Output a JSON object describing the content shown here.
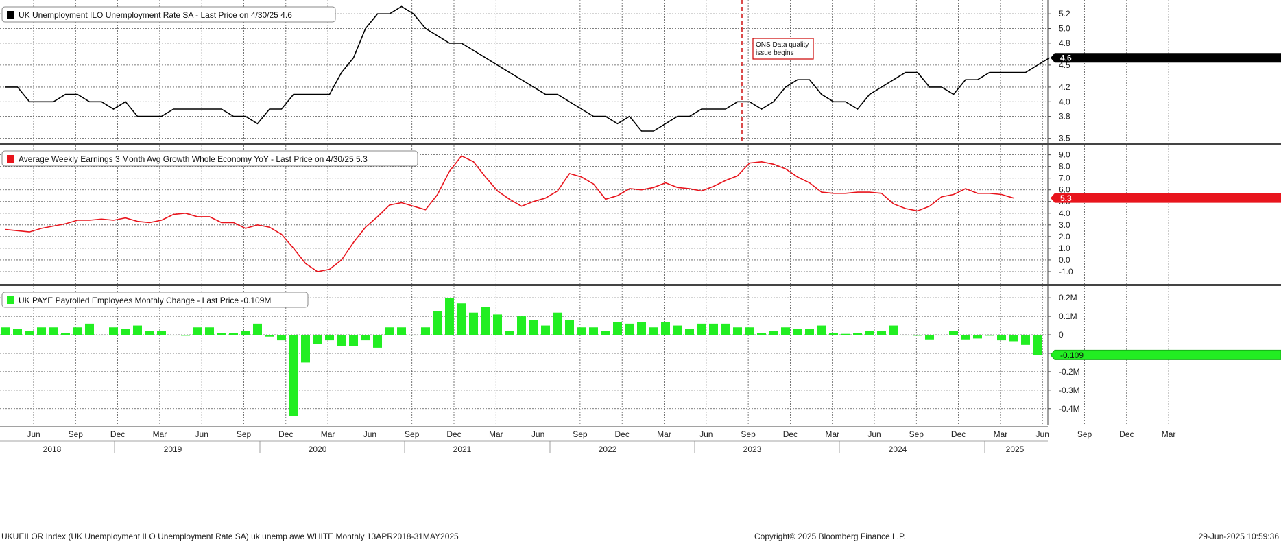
{
  "colors": {
    "unemp": "#000000",
    "awe": "#e8141c",
    "paye": "#22ee22",
    "paye_border": "#16b016",
    "grid": "#555555",
    "annotation": "#cc0000"
  },
  "x_axis": {
    "months": [
      "Jun",
      "Sep",
      "Dec",
      "Mar",
      "Jun",
      "Sep",
      "Dec",
      "Mar",
      "Jun",
      "Sep",
      "Dec",
      "Mar",
      "Jun",
      "Sep",
      "Dec",
      "Mar",
      "Jun",
      "Sep",
      "Dec",
      "Mar",
      "Jun",
      "Sep",
      "Dec",
      "Mar",
      "Jun",
      "Sep",
      "Dec",
      "Mar"
    ],
    "years": [
      "2018",
      "2019",
      "2020",
      "2021",
      "2022",
      "2023",
      "2024",
      "2025"
    ]
  },
  "footer": {
    "left": "UKUEILOR Index (UK Unemployment ILO Unemployment Rate SA) uk unemp awe WHITE  Monthly 13APR2018-31MAY2025",
    "center": "Copyright© 2025 Bloomberg Finance L.P.",
    "right": "29-Jun-2025 10:59:36"
  },
  "chart_data": [
    {
      "type": "line",
      "title": "UK Unemployment ILO Unemployment Rate SA - Last Price on 4/30/25 4.6",
      "last_value_label": "4.6",
      "y_ticks": [
        "3.5",
        "3.8",
        "4.0",
        "4.2",
        "4.5",
        "4.8",
        "5.0",
        "5.2"
      ],
      "ylim": [
        3.45,
        5.37
      ],
      "annotation": {
        "lines": [
          "ONS Data quality",
          "issue begins"
        ],
        "x_index": 62
      },
      "series": [
        {
          "values": [
            4.2,
            4.2,
            4.0,
            4.0,
            4.0,
            4.1,
            4.1,
            4.0,
            4.0,
            3.9,
            4.0,
            3.8,
            3.8,
            3.8,
            3.9,
            3.9,
            3.9,
            3.9,
            3.9,
            3.8,
            3.8,
            3.7,
            3.9,
            3.9,
            4.1,
            4.1,
            4.1,
            4.1,
            4.4,
            4.6,
            5.0,
            5.2,
            5.2,
            5.3,
            5.2,
            5.0,
            4.9,
            4.8,
            4.8,
            4.7,
            4.6,
            4.5,
            4.4,
            4.3,
            4.2,
            4.1,
            4.1,
            4.0,
            3.9,
            3.8,
            3.8,
            3.7,
            3.8,
            3.6,
            3.6,
            3.7,
            3.8,
            3.8,
            3.9,
            3.9,
            3.9,
            4.0,
            4.0,
            3.9,
            4.0,
            4.2,
            4.3,
            4.3,
            4.1,
            4.0,
            4.0,
            3.9,
            4.1,
            4.2,
            4.3,
            4.4,
            4.4,
            4.2,
            4.2,
            4.1,
            4.3,
            4.3,
            4.4,
            4.4,
            4.4,
            4.4,
            4.5,
            4.6
          ]
        }
      ]
    },
    {
      "type": "line",
      "title": "Average Weekly Earnings 3 Month Avg Growth Whole Economy YoY - Last Price on 4/30/25 5.3",
      "last_value_label": "5.3",
      "y_ticks": [
        "-1.0",
        "0.0",
        "1.0",
        "2.0",
        "3.0",
        "4.0",
        "5.0",
        "6.0",
        "7.0",
        "8.0",
        "9.0"
      ],
      "ylim": [
        -2.0,
        9.8
      ],
      "series": [
        {
          "values": [
            2.6,
            2.5,
            2.4,
            2.7,
            2.9,
            3.1,
            3.4,
            3.4,
            3.5,
            3.4,
            3.6,
            3.3,
            3.2,
            3.4,
            3.9,
            4.0,
            3.7,
            3.7,
            3.2,
            3.2,
            2.7,
            3.0,
            2.8,
            2.2,
            1.0,
            -0.3,
            -1.0,
            -0.8,
            0.0,
            1.5,
            2.8,
            3.7,
            4.7,
            4.9,
            4.6,
            4.3,
            5.6,
            7.6,
            8.9,
            8.4,
            7.1,
            5.9,
            5.2,
            4.6,
            5.0,
            5.3,
            5.9,
            7.4,
            7.1,
            6.5,
            5.2,
            5.5,
            6.1,
            6.0,
            6.2,
            6.6,
            6.2,
            6.1,
            5.9,
            6.3,
            6.8,
            7.2,
            8.3,
            8.4,
            8.2,
            7.8,
            7.1,
            6.6,
            5.8,
            5.7,
            5.7,
            5.8,
            5.8,
            5.7,
            4.8,
            4.4,
            4.2,
            4.6,
            5.4,
            5.6,
            6.1,
            5.7,
            5.7,
            5.6,
            5.3
          ]
        }
      ]
    },
    {
      "type": "bar",
      "title": "UK PAYE Payrolled Employees Monthly Change - Last Price -0.109M",
      "last_value_label": "-0.109",
      "y_ticks": [
        "-0.4M",
        "-0.3M",
        "-0.2M",
        "-0.1M",
        "0",
        "0.1M",
        "0.2M"
      ],
      "ylim": [
        -0.49,
        0.26
      ],
      "series": [
        {
          "values": [
            0.04,
            0.03,
            0.02,
            0.04,
            0.04,
            0.01,
            0.04,
            0.06,
            0.0,
            0.04,
            0.03,
            0.05,
            0.02,
            0.02,
            0.0,
            -0.005,
            0.04,
            0.04,
            0.01,
            0.01,
            0.02,
            0.06,
            -0.01,
            -0.03,
            -0.44,
            -0.15,
            -0.05,
            -0.03,
            -0.06,
            -0.06,
            -0.03,
            -0.07,
            0.04,
            0.04,
            0.0,
            0.04,
            0.13,
            0.2,
            0.17,
            0.12,
            0.15,
            0.11,
            0.02,
            0.1,
            0.08,
            0.05,
            0.12,
            0.08,
            0.04,
            0.04,
            0.02,
            0.07,
            0.06,
            0.07,
            0.04,
            0.07,
            0.05,
            0.03,
            0.06,
            0.06,
            0.06,
            0.04,
            0.04,
            0.01,
            0.02,
            0.04,
            0.03,
            0.03,
            0.05,
            0.01,
            0.005,
            0.01,
            0.02,
            0.02,
            0.05,
            0.0,
            -0.005,
            -0.025,
            0.0,
            0.02,
            -0.025,
            -0.02,
            -0.005,
            -0.03,
            -0.035,
            -0.055,
            -0.109
          ]
        }
      ]
    }
  ]
}
